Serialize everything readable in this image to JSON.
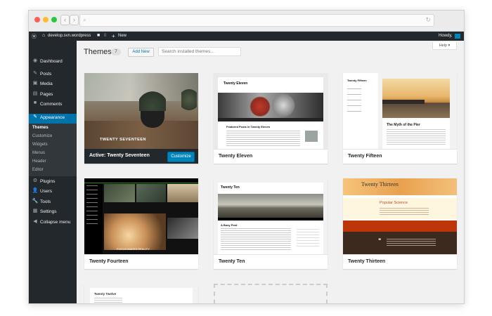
{
  "browser": {
    "back": "‹",
    "forward": "›"
  },
  "admin_bar": {
    "site": "develop.svn.wordpress",
    "comments": "0",
    "new": "New",
    "howdy": "Howdy,"
  },
  "sidebar": {
    "items": [
      {
        "icon": "dashboard-icon",
        "glyph": "◉",
        "label": "Dashboard"
      },
      {
        "icon": "posts-icon",
        "glyph": "✎",
        "label": "Posts"
      },
      {
        "icon": "media-icon",
        "glyph": "▣",
        "label": "Media"
      },
      {
        "icon": "pages-icon",
        "glyph": "▤",
        "label": "Pages"
      },
      {
        "icon": "comments-icon",
        "glyph": "■",
        "label": "Comments"
      },
      {
        "icon": "appearance-icon",
        "glyph": "✎",
        "label": "Appearance"
      },
      {
        "icon": "plugins-icon",
        "glyph": "⚙",
        "label": "Plugins"
      },
      {
        "icon": "users-icon",
        "glyph": "👤",
        "label": "Users"
      },
      {
        "icon": "tools-icon",
        "glyph": "🔧",
        "label": "Tools"
      },
      {
        "icon": "settings-icon",
        "glyph": "▦",
        "label": "Settings"
      },
      {
        "icon": "collapse-icon",
        "glyph": "◀",
        "label": "Collapse menu"
      }
    ],
    "submenu": [
      "Themes",
      "Customize",
      "Widgets",
      "Menus",
      "Header",
      "Editor"
    ]
  },
  "page": {
    "title": "Themes",
    "count": "7",
    "add_new": "Add New",
    "search_placeholder": "Search installed themes...",
    "help": "Help ▾"
  },
  "themes": [
    {
      "name": "Active: Twenty Seventeen",
      "customize": "Customize",
      "screenshot_text": "TWENTY SEVENTEEN"
    },
    {
      "name": "Twenty Eleven",
      "screenshot_title": "Twenty Eleven",
      "screenshot_heading": "Featured Posts in Twenty Eleven"
    },
    {
      "name": "Twenty Fifteen",
      "screenshot_title": "Twenty Fifteen",
      "screenshot_heading": "The Myth of the Pier"
    },
    {
      "name": "Twenty Fourteen",
      "screenshot_text": "FOCUS MAKES REALITY"
    },
    {
      "name": "Twenty Ten",
      "screenshot_title": "Twenty Ten",
      "screenshot_heading": "A Busy Post"
    },
    {
      "name": "Twenty Thirteen",
      "screenshot_title": "Twenty Thirteen",
      "screenshot_heading": "Popular Science"
    },
    {
      "name": "Twenty Twelve",
      "screenshot_title": "Twenty Twelve"
    }
  ],
  "colors": {
    "admin_dark": "#23282d",
    "accent": "#0073aa",
    "button": "#0085ba"
  }
}
